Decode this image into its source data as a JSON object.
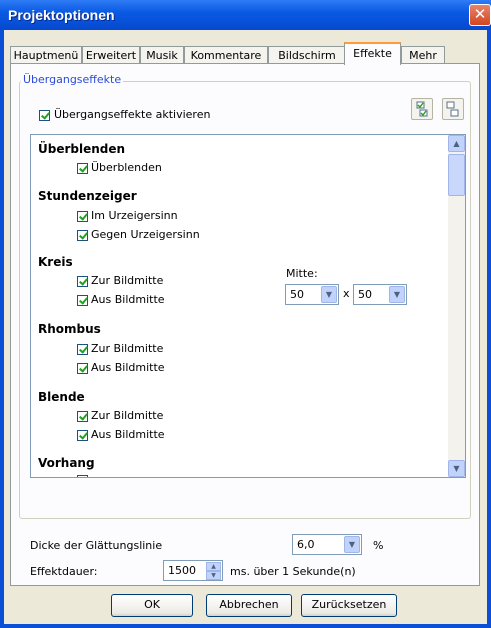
{
  "window": {
    "title": "Projektoptionen",
    "close_glyph": "✕"
  },
  "tabs": [
    {
      "label": "Hauptmenü"
    },
    {
      "label": "Erweitert"
    },
    {
      "label": "Musik"
    },
    {
      "label": "Kommentare"
    },
    {
      "label": "Bildschirm"
    },
    {
      "label": "Effekte",
      "active": true
    },
    {
      "label": "Mehr"
    }
  ],
  "group": {
    "label": "Übergangseffekte",
    "enable_label": "Übergangseffekte aktivieren",
    "enable_checked": true,
    "select_all_icon": "check-all-icon",
    "select_none_icon": "uncheck-all-icon"
  },
  "effects": {
    "sections": [
      {
        "title": "Überblenden",
        "options": [
          {
            "label": "Überblenden",
            "checked": true
          }
        ]
      },
      {
        "title": "Stundenzeiger",
        "options": [
          {
            "label": "Im Urzeigersinn",
            "checked": true
          },
          {
            "label": "Gegen Urzeigersinn",
            "checked": true
          }
        ]
      },
      {
        "title": "Kreis",
        "options": [
          {
            "label": "Zur Bildmitte",
            "checked": true
          },
          {
            "label": "Aus Bildmitte",
            "checked": true
          }
        ]
      },
      {
        "title": "Rhombus",
        "options": [
          {
            "label": "Zur Bildmitte",
            "checked": true
          },
          {
            "label": "Aus Bildmitte",
            "checked": true
          }
        ]
      },
      {
        "title": "Blende",
        "options": [
          {
            "label": "Zur Bildmitte",
            "checked": true
          },
          {
            "label": "Aus Bildmitte",
            "checked": true
          }
        ]
      },
      {
        "title": "Vorhang",
        "options": []
      }
    ],
    "center": {
      "label": "Mitte:",
      "x_value": "50",
      "separator": "x",
      "y_value": "50"
    }
  },
  "smoothing": {
    "label": "Dicke der Glättungslinie",
    "value": "6,0",
    "unit": "%"
  },
  "duration": {
    "label": "Effektdauer:",
    "value": "1500",
    "unit_text": "ms.  über 1 Sekunde(n)"
  },
  "buttons": {
    "ok": "OK",
    "cancel": "Abbrechen",
    "reset": "Zurücksetzen"
  },
  "icons": {
    "dropdown": "▼",
    "scroll_up": "▲",
    "scroll_down": "▼",
    "spin_up": "▲",
    "spin_down": "▼"
  }
}
